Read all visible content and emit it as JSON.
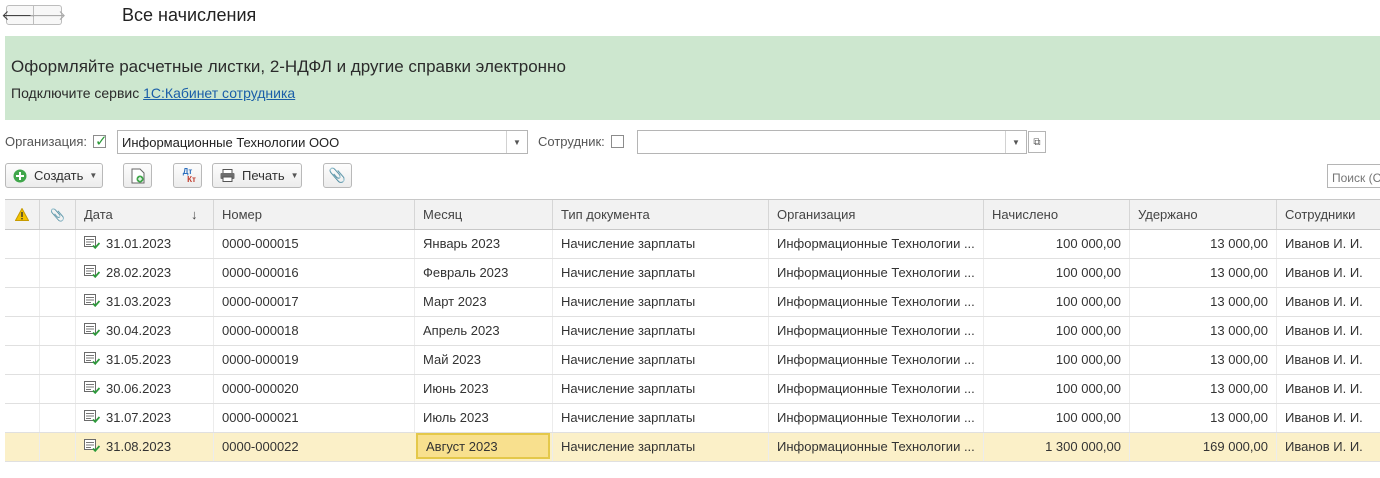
{
  "window": {
    "title": "Все начисления",
    "back_icon": "arrow-left-icon",
    "forward_icon": "arrow-right-icon"
  },
  "banner": {
    "heading": "Оформляйте расчетные листки, 2-НДФЛ и другие справки электронно",
    "text": "Подключите сервис",
    "link": "1С:Кабинет сотрудника",
    "background": "#cde7cf"
  },
  "filters": {
    "org_label": "Организация:",
    "org_checked": true,
    "org_value": "Информационные Технологии ООО",
    "employee_label": "Сотрудник:",
    "employee_checked": false,
    "employee_value": ""
  },
  "toolbar": {
    "create_label": "Создать",
    "print_label": "Печать",
    "dtkt_label_top": "Дт",
    "dtkt_label_bottom": "Кт",
    "search_placeholder": "Поиск (С"
  },
  "table": {
    "columns": [
      "Дата",
      "Номер",
      "Месяц",
      "Тип документа",
      "Организация",
      "Начислено",
      "Удержано",
      "Сотрудники"
    ],
    "sort_indicator": "↓",
    "rows": [
      {
        "date": "31.01.2023",
        "number": "0000-000015",
        "month": "Январь 2023",
        "type": "Начисление зарплаты",
        "org": "Информационные Технологии ...",
        "accrued": "100 000,00",
        "withheld": "13 000,00",
        "employees": "Иванов И. И."
      },
      {
        "date": "28.02.2023",
        "number": "0000-000016",
        "month": "Февраль 2023",
        "type": "Начисление зарплаты",
        "org": "Информационные Технологии ...",
        "accrued": "100 000,00",
        "withheld": "13 000,00",
        "employees": "Иванов И. И."
      },
      {
        "date": "31.03.2023",
        "number": "0000-000017",
        "month": "Март 2023",
        "type": "Начисление зарплаты",
        "org": "Информационные Технологии ...",
        "accrued": "100 000,00",
        "withheld": "13 000,00",
        "employees": "Иванов И. И."
      },
      {
        "date": "30.04.2023",
        "number": "0000-000018",
        "month": "Апрель 2023",
        "type": "Начисление зарплаты",
        "org": "Информационные Технологии ...",
        "accrued": "100 000,00",
        "withheld": "13 000,00",
        "employees": "Иванов И. И."
      },
      {
        "date": "31.05.2023",
        "number": "0000-000019",
        "month": "Май 2023",
        "type": "Начисление зарплаты",
        "org": "Информационные Технологии ...",
        "accrued": "100 000,00",
        "withheld": "13 000,00",
        "employees": "Иванов И. И."
      },
      {
        "date": "30.06.2023",
        "number": "0000-000020",
        "month": "Июнь 2023",
        "type": "Начисление зарплаты",
        "org": "Информационные Технологии ...",
        "accrued": "100 000,00",
        "withheld": "13 000,00",
        "employees": "Иванов И. И."
      },
      {
        "date": "31.07.2023",
        "number": "0000-000021",
        "month": "Июль 2023",
        "type": "Начисление зарплаты",
        "org": "Информационные Технологии ...",
        "accrued": "100 000,00",
        "withheld": "13 000,00",
        "employees": "Иванов И. И."
      },
      {
        "date": "31.08.2023",
        "number": "0000-000022",
        "month": "Август 2023",
        "type": "Начисление зарплаты",
        "org": "Информационные Технологии ...",
        "accrued": "1 300 000,00",
        "withheld": "169 000,00",
        "employees": "Иванов И. И."
      }
    ],
    "selected_row": 7
  },
  "colors": {
    "accent_green": "#2c9a3a",
    "selection": "#fbf0c8",
    "focus_cell": "#f8e08e",
    "link": "#1a5ea8"
  }
}
